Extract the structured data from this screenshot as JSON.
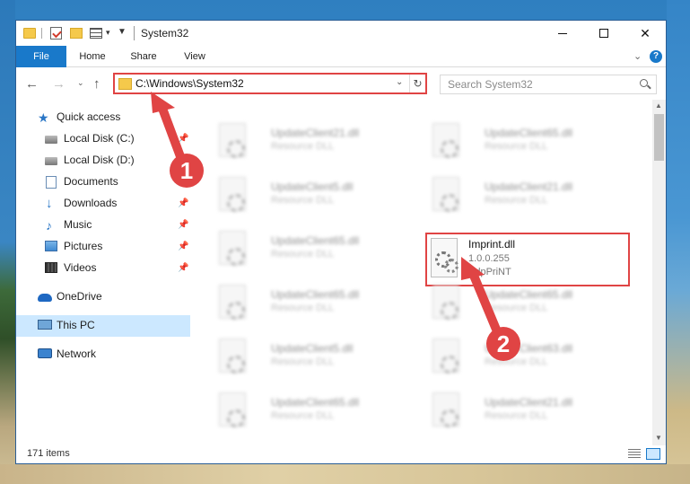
{
  "window": {
    "title": "System32"
  },
  "ribbon": {
    "tabs": [
      "File",
      "Home",
      "Share",
      "View"
    ],
    "help": "?"
  },
  "address": {
    "path": "C:\\Windows\\System32"
  },
  "search": {
    "placeholder": "Search System32"
  },
  "sidebar": {
    "items": [
      {
        "label": "Quick access",
        "icon": "star-icon",
        "pinned": false
      },
      {
        "label": "Local Disk (C:)",
        "icon": "disk-icon",
        "pinned": true
      },
      {
        "label": "Local Disk (D:)",
        "icon": "disk-icon",
        "pinned": false
      },
      {
        "label": "Documents",
        "icon": "documents-icon",
        "pinned": true
      },
      {
        "label": "Downloads",
        "icon": "download-icon",
        "pinned": true
      },
      {
        "label": "Music",
        "icon": "music-icon",
        "pinned": true
      },
      {
        "label": "Pictures",
        "icon": "pictures-icon",
        "pinned": true
      },
      {
        "label": "Videos",
        "icon": "videos-icon",
        "pinned": true
      },
      {
        "label": "OneDrive",
        "icon": "onedrive-icon",
        "pinned": false
      },
      {
        "label": "This PC",
        "icon": "pc-icon",
        "pinned": false,
        "selected": true
      },
      {
        "label": "Network",
        "icon": "network-icon",
        "pinned": false
      }
    ],
    "pin_glyph": "📌"
  },
  "files": {
    "left_column": [
      {
        "name": "UpdateClient21.dll",
        "type": "Resource DLL"
      },
      {
        "name": "UpdateClient5.dll",
        "type": "Resource DLL"
      },
      {
        "name": "UpdateClient65.dll",
        "type": "Resource DLL"
      },
      {
        "name": "UpdateClient65.dll",
        "type": "Resource DLL"
      },
      {
        "name": "UpdateClient5.dll",
        "type": "Resource DLL"
      },
      {
        "name": "UpdateClient65.dll",
        "type": "Resource DLL"
      }
    ],
    "right_column": [
      {
        "name": "UpdateClient65.dll",
        "type": "Resource DLL"
      },
      {
        "name": "UpdateClient21.dll",
        "type": "Resource DLL"
      },
      null,
      {
        "name": "UpdateClient65.dll",
        "type": "Resource DLL"
      },
      {
        "name": "UpdateClient63.dll",
        "type": "Resource DLL"
      },
      {
        "name": "UpdateClient21.dll",
        "type": "Resource DLL"
      }
    ],
    "highlighted": {
      "name": "Imprint.dll",
      "version": "1.0.0.255",
      "company": "PdpPriNT"
    }
  },
  "status": {
    "count": "171 items"
  },
  "annotations": {
    "step1": "1",
    "step2": "2",
    "color": "#e04444"
  }
}
